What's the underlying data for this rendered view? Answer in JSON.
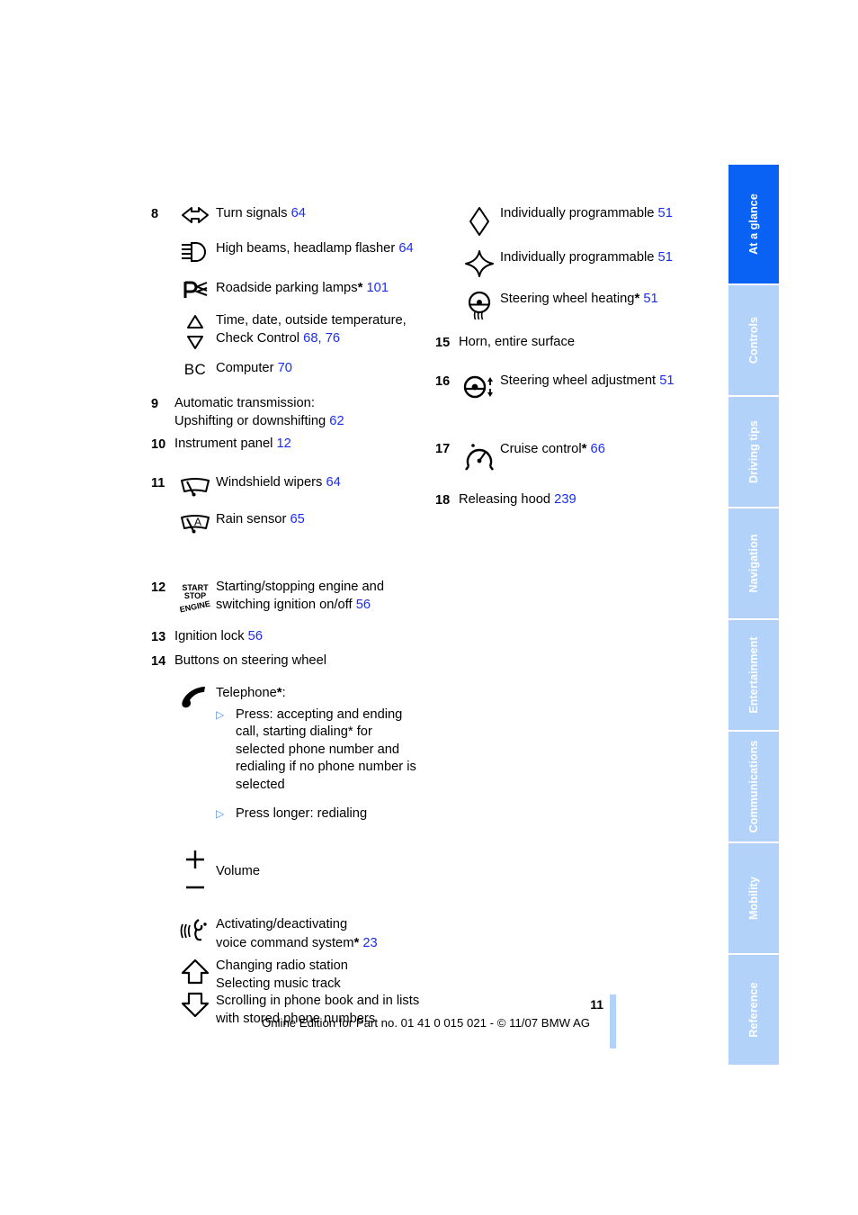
{
  "document": {
    "page_number": "11",
    "edition_line": "Online Edition for Part no. 01 41 0 015 021 - © 11/07 BMW AG"
  },
  "colors": {
    "page_ref_blue": "#1b2df0",
    "tab_active": "#0a62f5",
    "tab_inactive": "#b3d2fa",
    "bullet_blue": "#4f8df5"
  },
  "sidebar": {
    "tabs": [
      {
        "label": "At a glance",
        "active": true
      },
      {
        "label": "Controls",
        "active": false
      },
      {
        "label": "Driving tips",
        "active": false
      },
      {
        "label": "Navigation",
        "active": false
      },
      {
        "label": "Entertainment",
        "active": false
      },
      {
        "label": "Communications",
        "active": false
      },
      {
        "label": "Mobility",
        "active": false
      },
      {
        "label": "Reference",
        "active": false
      }
    ]
  },
  "left_column": {
    "item8": {
      "number": "8",
      "entries": [
        {
          "icon": "turn-signals-icon",
          "label": "Turn signals",
          "page": "64"
        },
        {
          "icon": "high-beams-icon",
          "label": "High beams, headlamp flasher",
          "page": "64"
        },
        {
          "icon": "roadside-parking-lamps-icon",
          "label": "Roadside parking lamps",
          "star": "*",
          "page": "101"
        },
        {
          "icon": "up-down-triangles-icon",
          "label_line1": "Time, date, outside temperature,",
          "label_line2": "Check Control",
          "page": "68",
          "page2": "76"
        },
        {
          "icon": "bc-computer-icon",
          "label": "Computer",
          "page": "70"
        }
      ]
    },
    "item9": {
      "number": "9",
      "line1": "Automatic transmission:",
      "line2": "Upshifting or downshifting",
      "page": "62"
    },
    "item10": {
      "number": "10",
      "label": "Instrument panel",
      "page": "12"
    },
    "item11": {
      "number": "11",
      "entries": [
        {
          "icon": "windshield-wipers-icon",
          "label": "Windshield wipers",
          "page": "64"
        },
        {
          "icon": "rain-sensor-icon",
          "label": "Rain sensor",
          "page": "65"
        }
      ]
    },
    "item12": {
      "number": "12",
      "icon": "start-stop-engine-icon",
      "icon_text_top": "START",
      "icon_text_mid": "STOP",
      "icon_text_bottom": "ENGINE",
      "line1": "Starting/stopping engine and",
      "line2": "switching ignition on/off",
      "page": "56"
    },
    "item13": {
      "number": "13",
      "label": "Ignition lock",
      "page": "56"
    },
    "item14": {
      "number": "14",
      "label": "Buttons on steering wheel",
      "telephone": {
        "icon": "telephone-handset-icon",
        "heading": "Telephone",
        "star": "*",
        "colon": ":",
        "bullets": [
          "Press: accepting and ending call, starting dialing* for selected phone number and redialing if no phone number is selected",
          "Press longer: redialing"
        ],
        "bullet1_lines": [
          "Press: accepting and ending",
          "call, starting dialing* for",
          "selected phone number and",
          "redialing if no phone number is",
          "selected"
        ],
        "bullet2_lines": [
          "Press longer: redialing"
        ]
      },
      "volume": {
        "icon_plus": "plus-icon",
        "icon_minus": "minus-icon",
        "label": "Volume"
      },
      "voice": {
        "icon": "voice-command-icon",
        "line1": "Activating/deactivating",
        "line2": "voice command system",
        "star": "*",
        "page": "23"
      },
      "arrows": {
        "icon_up": "arrow-up-icon",
        "icon_down": "arrow-down-icon",
        "line1": "Changing radio station",
        "line2": "Selecting music track",
        "line3": "Scrolling in phone book and in lists",
        "line4": "with stored phone numbers"
      }
    }
  },
  "right_column": {
    "programmable": [
      {
        "icon": "diamond-icon",
        "label": "Individually programmable",
        "page": "51"
      },
      {
        "icon": "star-four-point-icon",
        "label": "Individually programmable",
        "page": "51"
      },
      {
        "icon": "steering-wheel-heating-icon",
        "label": "Steering wheel heating",
        "star": "*",
        "page": "51"
      }
    ],
    "item15": {
      "number": "15",
      "label": "Horn, entire surface"
    },
    "item16": {
      "number": "16",
      "icon": "steering-wheel-adjustment-icon",
      "label": "Steering wheel adjustment",
      "page": "51"
    },
    "item17": {
      "number": "17",
      "icon": "cruise-control-icon",
      "label": "Cruise control",
      "star": "*",
      "page": "66"
    },
    "item18": {
      "number": "18",
      "label": "Releasing hood",
      "page": "239"
    }
  }
}
